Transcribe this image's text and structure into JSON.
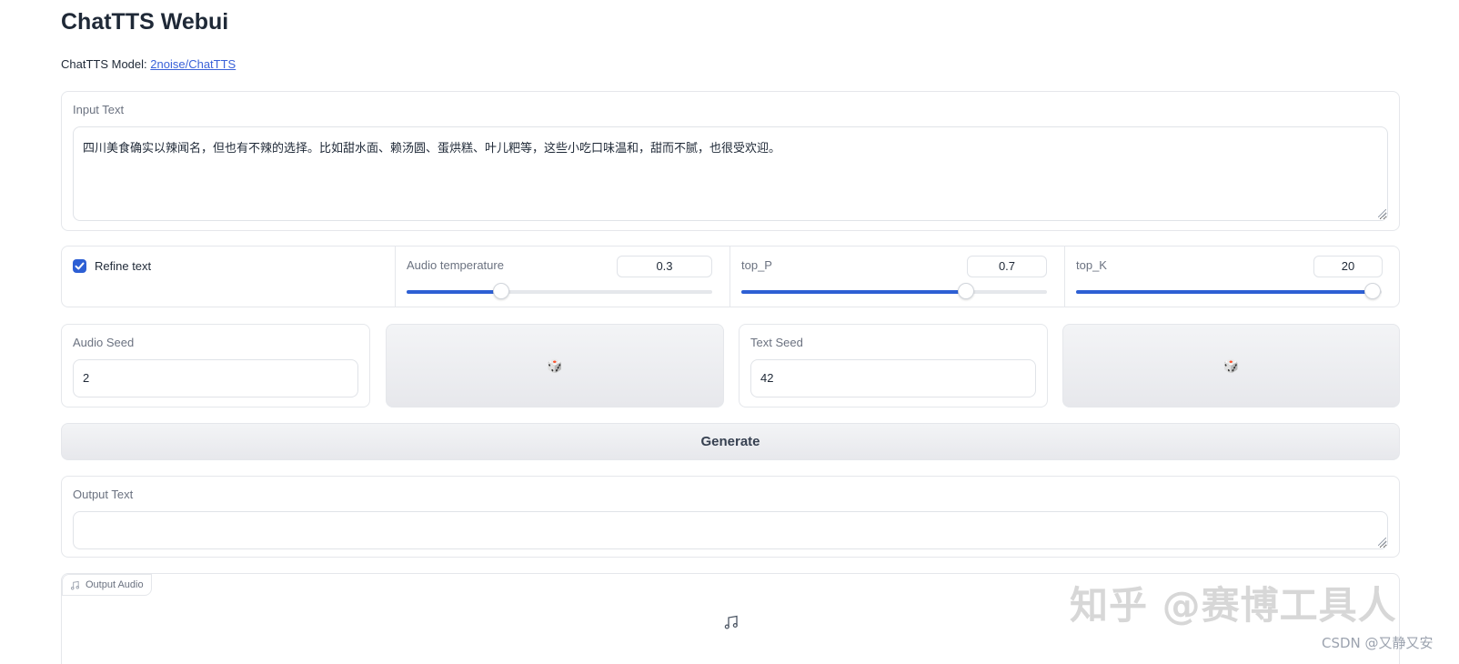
{
  "app": {
    "title": "ChatTTS Webui",
    "model_label": "ChatTTS Model:",
    "model_link": "2noise/ChatTTS"
  },
  "input_text": {
    "label": "Input Text",
    "value": "四川美食确实以辣闻名，但也有不辣的选择。比如甜水面、赖汤圆、蛋烘糕、叶儿粑等，这些小吃口味温和，甜而不腻，也很受欢迎。"
  },
  "controls": {
    "refine_text": {
      "label": "Refine text",
      "checked": true
    },
    "audio_temperature": {
      "label": "Audio temperature",
      "value": "0.3",
      "fraction": 0.31
    },
    "top_p": {
      "label": "top_P",
      "value": "0.7",
      "fraction": 0.735
    },
    "top_k": {
      "label": "top_K",
      "value": "20",
      "fraction": 0.97
    }
  },
  "seeds": {
    "audio_seed": {
      "label": "Audio Seed",
      "value": "2"
    },
    "audio_dice_icon": "🎲",
    "text_seed": {
      "label": "Text Seed",
      "value": "42"
    },
    "text_dice_icon": "🎲"
  },
  "generate_label": "Generate",
  "output_text": {
    "label": "Output Text",
    "value": ""
  },
  "output_audio": {
    "label": "Output Audio",
    "icon": "music-note-icon"
  },
  "watermarks": {
    "zhihu": "知乎 @赛博工具人",
    "csdn": "CSDN @又静又安"
  },
  "colors": {
    "accent": "#2d5fd4",
    "link": "#3b62d9"
  }
}
